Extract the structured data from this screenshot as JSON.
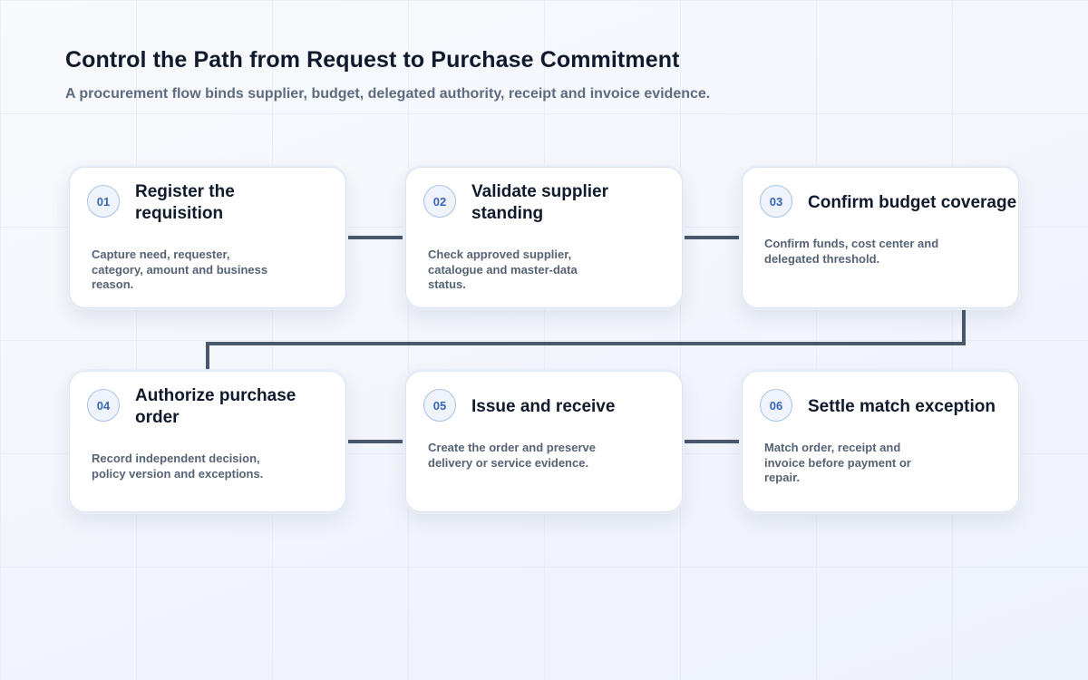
{
  "header": {
    "title": "Control the Path from Request to Purchase Commitment",
    "subtitle": "A procurement flow binds supplier, budget, delegated authority, receipt and invoice evidence."
  },
  "steps": [
    {
      "number": "01",
      "title": "Register the\nrequisition",
      "description": "Capture need, requester,\ncategory, amount and business\nreason."
    },
    {
      "number": "02",
      "title": "Validate supplier\nstanding",
      "description": "Check approved supplier,\ncatalogue and master-data\nstatus."
    },
    {
      "number": "03",
      "title": "Confirm budget coverage",
      "description": "Confirm funds, cost center and\ndelegated threshold."
    },
    {
      "number": "04",
      "title": "Authorize purchase\norder",
      "description": "Record independent decision,\npolicy version and exceptions."
    },
    {
      "number": "05",
      "title": "Issue and receive",
      "description": "Create the order and preserve\ndelivery or service evidence."
    },
    {
      "number": "06",
      "title": "Settle match exception",
      "description": "Match order, receipt and\ninvoice before payment or\nrepair."
    }
  ],
  "colors": {
    "connector": "#4a586c",
    "badge_text": "#3a64b4",
    "badge_border": "#a8c2e8",
    "title_text": "#101a2c",
    "body_text": "#566275"
  }
}
